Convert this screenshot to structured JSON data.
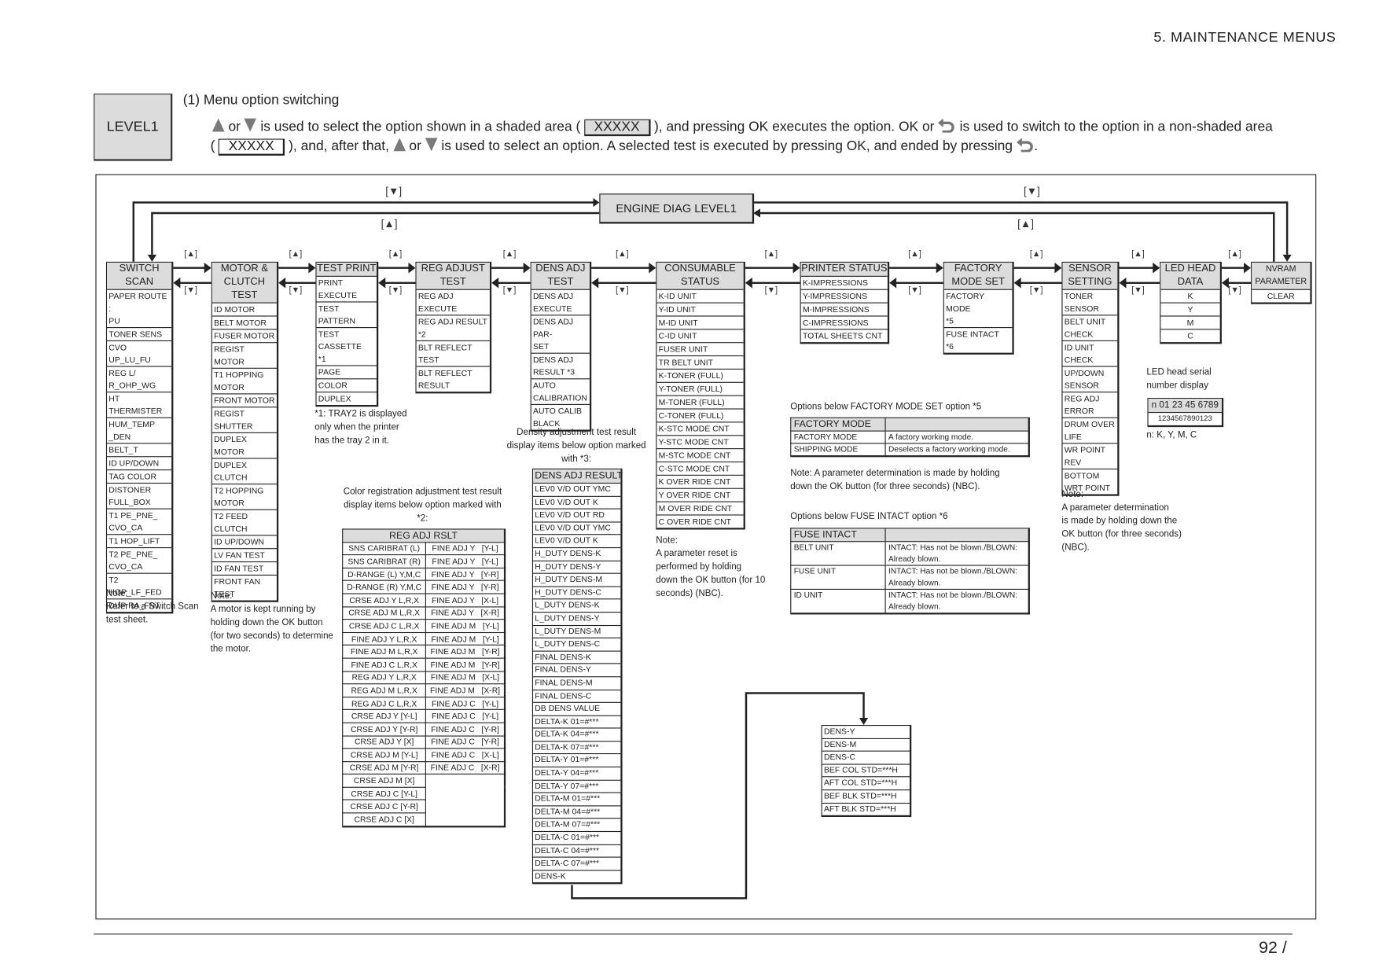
{
  "page": {
    "section_title": "5.  MAINTENANCE MENUS",
    "page_number": "92 /"
  },
  "level_label": "LEVEL1",
  "instructions": {
    "heading": "(1)  Menu option switching",
    "line1": {
      "a": " or ",
      "b": " is used to select the option shown in a shaded area ( ",
      "box": "XXXXX",
      "c": " ), and pressing OK executes the option. OK or ",
      "d": " is used to switch to the option in a non-shaded area"
    },
    "line2": {
      "a": "( ",
      "box": "XXXXX",
      "b": " ), and, after that, ",
      "c": " or ",
      "d": " is used to select an option. A selected test is executed by pressing OK, and ended by pressing ",
      "e": "."
    }
  },
  "icons": {
    "up": "up-triangle-icon",
    "down": "down-triangle-icon",
    "back": "return-arrow-icon"
  },
  "engine_diag": "ENGINE DIAG LEVEL1",
  "arrow_labels": {
    "up": "[▲]",
    "down": "[▼]"
  },
  "columns": [
    {
      "title": "SWITCH\nSCAN",
      "items": [
        "PAPER ROUTE :\nPU",
        "TONER SENS",
        "CVO UP_LU_FU",
        "REG L/\nR_OHP_WG",
        "HT\nTHERMISTER",
        "HUM_TEMP\n_DEN",
        "BELT_T",
        "ID UP/DOWN",
        "TAG COLOR",
        "DISTONER\nFULL_BOX",
        "T1 PE_PNE_\nCVO_CA",
        "T1 HOP_LIFT",
        "T2 PE_PNE_\nCVO_CA",
        "T2\nHOP_LF_FED",
        "DUP RA_FNT"
      ]
    },
    {
      "title": "MOTOR &\nCLUTCH\nTEST",
      "items": [
        "ID MOTOR",
        "BELT MOTOR",
        "FUSER MOTOR",
        "REGIST MOTOR",
        "T1 HOPPING\nMOTOR",
        "FRONT MOTOR",
        "REGIST\nSHUTTER",
        "DUPLEX\nMOTOR",
        "DUPLEX\nCLUTCH",
        "T2 HOPPING\nMOTOR",
        "T2 FEED\nCLUTCH",
        "ID UP/DOWN",
        "LV FAN TEST",
        "ID FAN TEST",
        "FRONT FAN\nTEST"
      ]
    },
    {
      "title": "TEST PRINT",
      "items": [
        "PRINT\nEXECUTE",
        "TEST\nPATTERN",
        "TEST\nCASSETTE\n*1",
        "PAGE",
        "COLOR",
        "DUPLEX"
      ]
    },
    {
      "title": "REG ADJUST\nTEST",
      "items": [
        "REG ADJ\nEXECUTE",
        "REG ADJ RESULT\n*2",
        "BLT REFLECT TEST",
        "BLT REFLECT\nRESULT"
      ]
    },
    {
      "title": "DENS ADJ\nTEST",
      "items": [
        "DENS ADJ\nEXECUTE",
        "DENS ADJ PAR-\nSET",
        "DENS ADJ\nRESULT *3",
        "AUTO\nCALIBRATION",
        "AUTO CALIB\nBLACK"
      ]
    },
    {
      "title": "CONSUMABLE\nSTATUS",
      "items": [
        "K-ID UNIT",
        "Y-ID UNIT",
        "M-ID UNIT",
        "C-ID UNIT",
        "FUSER UNIT",
        "TR BELT UNIT",
        "K-TONER (FULL)",
        "Y-TONER (FULL)",
        "M-TONER (FULL)",
        "C-TONER (FULL)",
        "K-STC MODE CNT",
        "Y-STC MODE CNT",
        "M-STC MODE CNT",
        "C-STC MODE CNT",
        "K OVER RIDE CNT",
        "Y OVER RIDE CNT",
        "M OVER RIDE CNT",
        "C OVER RIDE CNT"
      ]
    },
    {
      "title": "PRINTER STATUS",
      "items": [
        "K-IMPRESSIONS",
        "Y-IMPRESSIONS",
        "M-IMPRESSIONS",
        "C-IMPRESSIONS",
        "TOTAL SHEETS CNT"
      ]
    },
    {
      "title": "FACTORY\nMODE SET",
      "items": [
        "FACTORY MODE\n*5",
        "FUSE INTACT\n*6"
      ]
    },
    {
      "title": "SENSOR\nSETTING",
      "items": [
        "TONER\nSENSOR",
        "BELT UNIT\nCHECK",
        "ID UNIT\nCHECK",
        "UP/DOWN\nSENSOR",
        "REG ADJ\nERROR",
        "DRUM OVER\nLIFE",
        "WR POINT\nREV",
        "BOTTOM\nWRT POINT"
      ]
    },
    {
      "title": "LED HEAD\nDATA",
      "items": [
        "K",
        "Y",
        "M",
        "C"
      ]
    },
    {
      "title": "NVRAM\nPARAMETER",
      "items": [
        "CLEAR"
      ]
    }
  ],
  "notes": {
    "switch_scan": "Note:\nRefer to a Switch Scan\ntest sheet.",
    "motor": "Note:\nA motor is kept running by\nholding down the OK button\n(for two seconds) to determine\nthe motor.",
    "tray2": "*1: TRAY2 is displayed\n      only when the printer\n      has the tray 2 in it.",
    "reg_caption": "Color registration adjustment test result\ndisplay items below option marked with\n*2:",
    "dens_caption": "Density adjustment test result\ndisplay items below option marked\nwith *3:",
    "consumable": "Note:\nA parameter reset is\nperformed by holding\ndown the OK button (for 10\nseconds) (NBC).",
    "factory_note": "Note:  A parameter determination is made by holding\n           down the OK button (for three seconds) (NBC).",
    "sensor": "Note:\nA parameter determination\nis made by holding down the\nOK button (for three seconds)\n(NBC)."
  },
  "reg_adj_rslt": {
    "title": "REG ADJ RSLT",
    "left": [
      "SNS CARIBRAT (L)",
      "SNS CARIBRAT (R)",
      "D-RANGE (L) Y,M,C",
      "D-RANGE (R) Y,M,C",
      "CRSE ADJ Y L,R,X",
      "CRSE ADJ M L,R,X",
      "CRSE ADJ C L,R,X",
      "FINE ADJ Y L,R,X",
      "FINE ADJ M L,R,X",
      "FINE ADJ C L,R,X",
      "REG ADJ Y L,R,X",
      "REG ADJ M L,R,X",
      "REG ADJ C L,R,X",
      "CRSE ADJ Y [Y-L]",
      "CRSE ADJ Y [Y-R]",
      "CRSE ADJ Y [X]",
      "CRSE ADJ M [Y-L]",
      "CRSE ADJ M [Y-R]",
      "CRSE ADJ M [X]",
      "CRSE ADJ C [Y-L]",
      "CRSE ADJ C [Y-R]",
      "CRSE ADJ C [X]"
    ],
    "right": [
      "FINE ADJ Y   [Y-L]",
      "FINE ADJ Y   [Y-L]",
      "FINE ADJ Y   [Y-R]",
      "FINE ADJ Y   [Y-R]",
      "FINE ADJ Y   [X-L]",
      "FINE ADJ Y   [X-R]",
      "FINE ADJ M   [Y-L]",
      "FINE ADJ M   [Y-L]",
      "FINE ADJ M   [Y-R]",
      "FINE ADJ M   [Y-R]",
      "FINE ADJ M   [X-L]",
      "FINE ADJ M   [X-R]",
      "FINE ADJ C   [Y-L]",
      "FINE ADJ C   [Y-L]",
      "FINE ADJ C   [Y-R]",
      "FINE ADJ C   [Y-R]",
      "FINE ADJ C   [X-L]",
      "FINE ADJ C   [X-R]"
    ]
  },
  "dens_adj_result": {
    "title": "DENS ADJ RESULT",
    "items": [
      "LEV0 V/D OUT YMC",
      "LEV0 V/D OUT K",
      "LEV0 V/D OUT RD",
      "LEV0 V/D OUT YMC",
      "LEV0 V/D OUT K",
      "H_DUTY DENS-K",
      "H_DUTY DENS-Y",
      "H_DUTY DENS-M",
      "H_DUTY DENS-C",
      "L_DUTY DENS-K",
      "L_DUTY DENS-Y",
      "L_DUTY DENS-M",
      "L_DUTY DENS-C",
      "FINAL DENS-K",
      "FINAL DENS-Y",
      "FINAL DENS-M",
      "FINAL DENS-C",
      "DB DENS VALUE",
      "DELTA-K 01=#***",
      "DELTA-K 04=#***",
      "DELTA-K 07=#***",
      "DELTA-Y 01=#***",
      "DELTA-Y 04=#***",
      "DELTA-Y 07=#***",
      "DELTA-M 01=#***",
      "DELTA-M 04=#***",
      "DELTA-M 07=#***",
      "DELTA-C 01=#***",
      "DELTA-C 04=#***",
      "DELTA-C 07=#***",
      "DENS-K"
    ],
    "continued": [
      "DENS-Y",
      "DENS-M",
      "DENS-C",
      "BEF COL STD=***H",
      "AFT COL STD=***H",
      "BEF BLK STD=***H",
      "AFT BLK STD=***H"
    ]
  },
  "factory_options": {
    "caption": "Options below FACTORY MODE SET option *5",
    "header": "FACTORY MODE",
    "rows": [
      [
        "FACTORY MODE",
        "A factory working mode."
      ],
      [
        "SHIPPING MODE",
        "Deselects a factory working mode."
      ]
    ]
  },
  "fuse_options": {
    "caption": "Options below FUSE INTACT option *6",
    "header": "FUSE INTACT",
    "rows": [
      [
        "BELT UNIT",
        "INTACT: Has not be blown./BLOWN:\nAlready blown."
      ],
      [
        "FUSE UNIT",
        "INTACT: Has not be blown./BLOWN:\nAlready blown."
      ],
      [
        "ID UNIT",
        "INTACT: Has not be blown./BLOWN:\nAlready blown."
      ]
    ]
  },
  "led_serial": {
    "caption": "LED head serial\nnumber display",
    "format": "n 01 23 45 6789",
    "example": "1234567890123",
    "legend": "n: K, Y, M, C"
  }
}
